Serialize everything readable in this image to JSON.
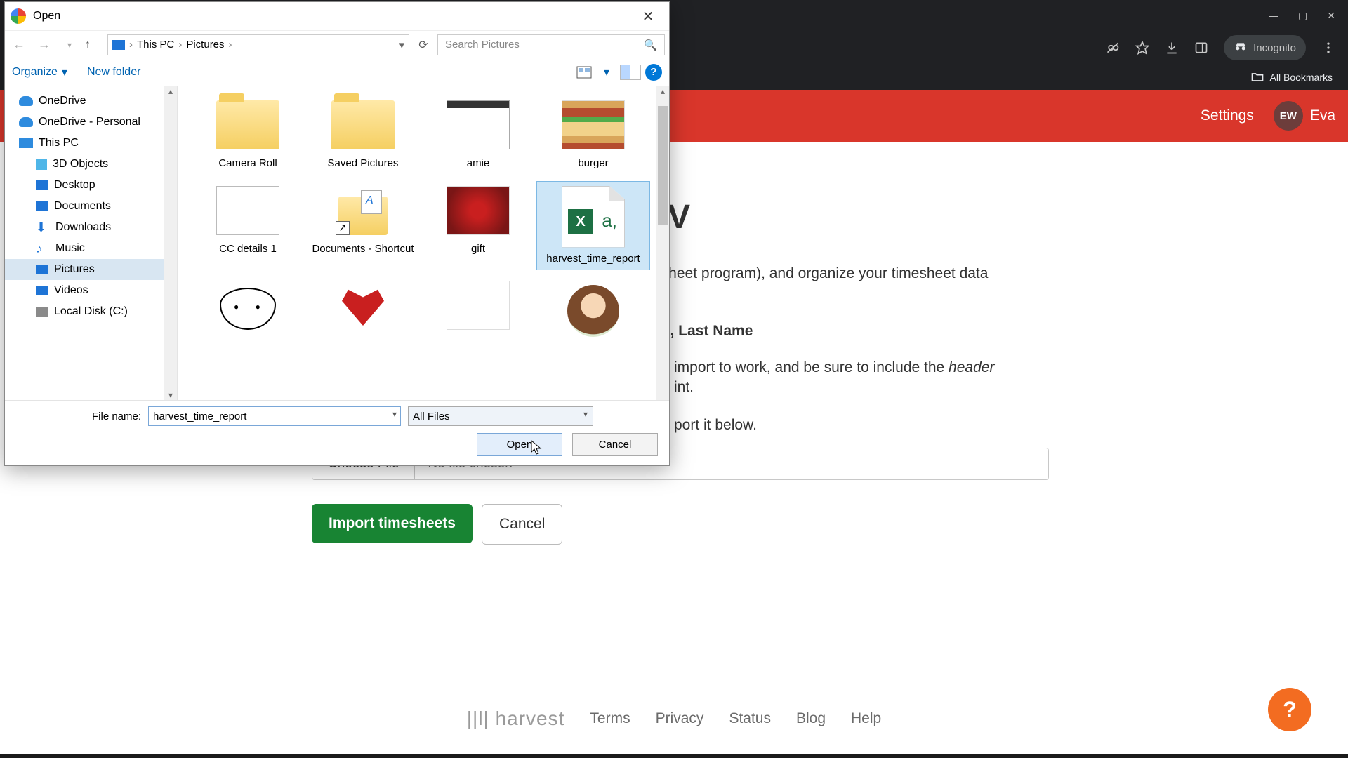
{
  "browser": {
    "win_min": "—",
    "win_max": "▢",
    "win_close": "✕",
    "incognito_label": "Incognito",
    "bookmarks_label": "All Bookmarks"
  },
  "harvest": {
    "settings": "Settings",
    "avatar_initials": "EW",
    "user_name": "Eva"
  },
  "page": {
    "title_partial": "SV",
    "line1_partial": "dsheet program), and organize your timesheet data",
    "line2_partial": "ne, Last Name",
    "line3_a": "import to work, and be sure to include the ",
    "line3_i": "header",
    "line4_partial": "int.",
    "line5_partial": "port it below.",
    "choose_btn": "Choose File",
    "no_file": "No file chosen",
    "import_btn": "Import timesheets",
    "cancel_btn": "Cancel"
  },
  "footer": {
    "logo": "||l| harvest",
    "links": [
      "Terms",
      "Privacy",
      "Status",
      "Blog",
      "Help"
    ]
  },
  "help_fab": "?",
  "dialog": {
    "title": "Open",
    "breadcrumb": {
      "root": "This PC",
      "leaf": "Pictures"
    },
    "search_placeholder": "Search Pictures",
    "organize": "Organize",
    "new_folder": "New folder",
    "tree": [
      {
        "label": "OneDrive",
        "icon": "cloud",
        "lvl": 1
      },
      {
        "label": "OneDrive - Personal",
        "icon": "cloud",
        "lvl": 1
      },
      {
        "label": "This PC",
        "icon": "pc",
        "lvl": 1
      },
      {
        "label": "3D Objects",
        "icon": "3d",
        "lvl": 2
      },
      {
        "label": "Desktop",
        "icon": "folder",
        "lvl": 2
      },
      {
        "label": "Documents",
        "icon": "folder",
        "lvl": 2
      },
      {
        "label": "Downloads",
        "icon": "download",
        "lvl": 2
      },
      {
        "label": "Music",
        "icon": "music",
        "lvl": 2
      },
      {
        "label": "Pictures",
        "icon": "pics",
        "lvl": 2,
        "selected": true
      },
      {
        "label": "Videos",
        "icon": "video",
        "lvl": 2
      },
      {
        "label": "Local Disk (C:)",
        "icon": "disk",
        "lvl": 2
      }
    ],
    "files": [
      {
        "label": "Camera Roll",
        "kind": "folder"
      },
      {
        "label": "Saved Pictures",
        "kind": "folder"
      },
      {
        "label": "amie",
        "kind": "amie"
      },
      {
        "label": "burger",
        "kind": "burger"
      },
      {
        "label": "CC details 1",
        "kind": "cc"
      },
      {
        "label": "Documents - Shortcut",
        "kind": "shortcut"
      },
      {
        "label": "gift",
        "kind": "gift"
      },
      {
        "label": "harvest_time_report",
        "kind": "csv",
        "selected": true
      },
      {
        "label": "",
        "kind": "face"
      },
      {
        "label": "",
        "kind": "heart"
      },
      {
        "label": "",
        "kind": "blank"
      },
      {
        "label": "",
        "kind": "avatar"
      }
    ],
    "filename_label": "File name:",
    "filename_value": "harvest_time_report",
    "filetype_value": "All Files",
    "open_btn": "Open",
    "cancel_btn": "Cancel"
  }
}
